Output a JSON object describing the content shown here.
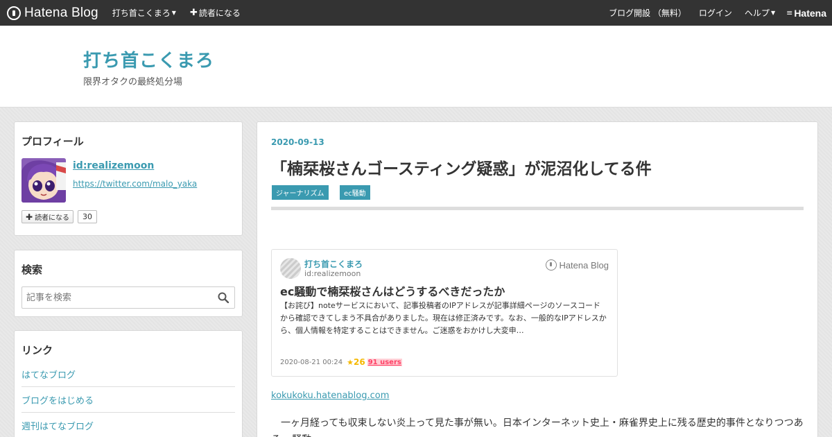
{
  "topbar": {
    "logo_text": "Hatena Blog",
    "blog_menu_label": "打ち首こくまろ",
    "subscribe_label": "読者になる",
    "open_blog_label": "ブログ開設 （無料）",
    "login_label": "ログイン",
    "help_label": "ヘルプ",
    "hatena_label": "Hatena"
  },
  "header": {
    "title": "打ち首こくまろ",
    "description": "限界オタクの最終処分場"
  },
  "sidebar": {
    "profile": {
      "heading": "プロフィール",
      "id_label": "id:realizemoon",
      "link": "https://twitter.com/malo_yaka",
      "subscribe_label": "読者になる",
      "subscriber_count": "30"
    },
    "search": {
      "heading": "検索",
      "placeholder": "記事を検索"
    },
    "links": {
      "heading": "リンク",
      "items": [
        "はてなブログ",
        "ブログをはじめる",
        "週刊はてなブログ"
      ]
    }
  },
  "article": {
    "date": "2020-09-13",
    "title": "「楠栞桜さんゴースティング疑惑」が泥沼化してる件",
    "categories": [
      "ジャーナリズム",
      "ec騒動"
    ],
    "embed": {
      "blog_name": "打ち首こくまろ",
      "author_id": "id:realizemoon",
      "brand": "Hatena Blog",
      "title": "ec騒動で楠栞桜さんはどうするべきだったか",
      "excerpt": "【お詫び】noteサービスにおいて、記事投稿者のIPアドレスが記事詳細ページのソースコードから確認できてしまう不具合がありました。現在は修正済みです。なお、一般的なIPアドレスから、個人情報を特定することはできません。ご迷惑をおかけし大変申…",
      "datetime": "2020-08-21 00:24",
      "stars": "26",
      "users": "91 users"
    },
    "embed_url": "kokukoku.hatenablog.com",
    "body_text": "一ヶ月経っても収束しない炎上って見た事が無い。日本インターネット史上・麻雀界史上に残る歴史的事件となりつつあるec騒動。"
  },
  "colors": {
    "accent": "#3a9ab0",
    "topbar_bg": "#333333",
    "star": "#f5b800",
    "users": "#ff4166"
  }
}
